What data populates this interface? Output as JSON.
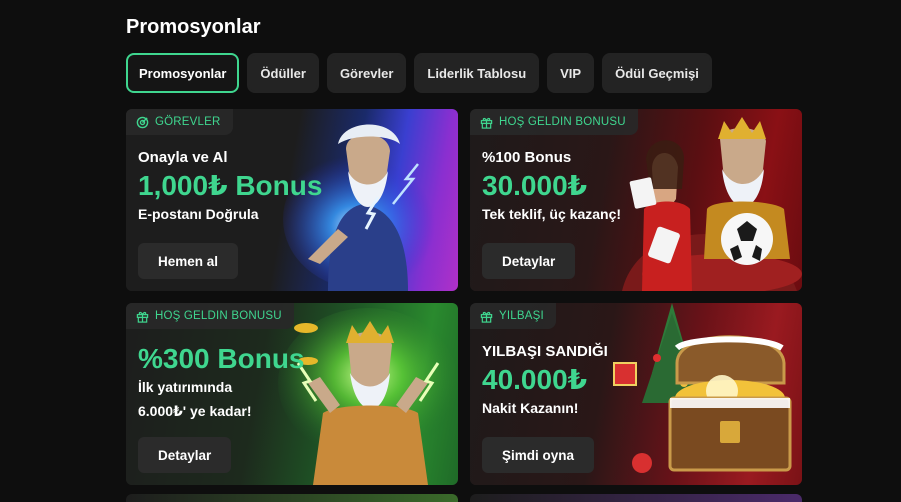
{
  "page": {
    "title": "Promosyonlar"
  },
  "tabs": [
    {
      "label": "Promosyonlar",
      "active": true
    },
    {
      "label": "Ödüller"
    },
    {
      "label": "Görevler"
    },
    {
      "label": "Liderlik Tablosu"
    },
    {
      "label": "VIP"
    },
    {
      "label": "Ödül Geçmişi"
    }
  ],
  "cards": [
    {
      "badge": "GÖREVLER",
      "badge_icon": "target-icon",
      "line1": "Onayla ve Al",
      "amount": "1,000₺ Bonus",
      "line3": "E-postanı Doğrula",
      "button": "Hemen al"
    },
    {
      "badge": "HOŞ GELDIN BONUSU",
      "badge_icon": "gift-icon",
      "line1": "%100 Bonus",
      "amount": "30.000₺",
      "line3": "Tek teklif, üç kazanç!",
      "button": "Detaylar"
    },
    {
      "badge": "HOŞ GELDIN BONUSU",
      "badge_icon": "gift-icon",
      "amount": "%300 Bonus",
      "line3a": "İlk yatırımında",
      "line3b": "6.000₺' ye kadar!",
      "button": "Detaylar"
    },
    {
      "badge": "YILBAŞI",
      "badge_icon": "gift-icon",
      "line1": "YILBAŞI SANDIĞI",
      "amount": "40.000₺",
      "line3": "Nakit Kazanın!",
      "button": "Şimdi oyna"
    }
  ],
  "colors": {
    "accent": "#3fd68f",
    "background": "#0e0e0e",
    "tab_bg": "#232323"
  }
}
